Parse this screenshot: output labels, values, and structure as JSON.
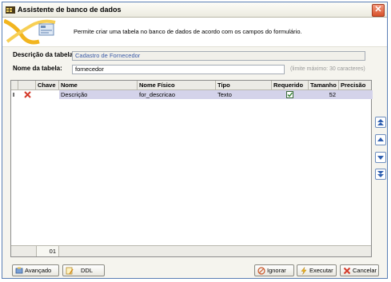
{
  "window": {
    "title": "Assistente de banco de dados"
  },
  "banner": {
    "text": "Permite criar uma tabela no banco de dados de acordo com os campos do formulário."
  },
  "form": {
    "descricao_label": "Descrição da tabela:",
    "descricao_value": "Cadastro de Fornecedor",
    "nome_label": "Nome da tabela:",
    "nome_value": "fornecedor",
    "nome_hint": "(limite máximo: 30 caracteres)"
  },
  "grid": {
    "columns": [
      "Chave",
      "Nome",
      "Nome Físico",
      "Tipo",
      "Requerido",
      "Tamanho",
      "Precisão"
    ],
    "rows": [
      {
        "indicator": "I",
        "chave": "",
        "nome": "Descrição",
        "nome_fisico": "for_descricao",
        "tipo": "Texto",
        "requerido": true,
        "tamanho": "52",
        "precisao": ""
      }
    ],
    "footer_count": "01"
  },
  "buttons": {
    "avancado": "Avançado",
    "ddl": "DDL",
    "ignorar": "Ignorar",
    "executar": "Executar",
    "cancelar": "Cancelar"
  },
  "side_buttons": [
    "move-first-icon",
    "move-up-icon",
    "move-down-icon",
    "move-last-icon"
  ],
  "colors": {
    "accent": "#3f6fbf",
    "selection": "#d4d3ea",
    "delete": "#d43a2a"
  }
}
